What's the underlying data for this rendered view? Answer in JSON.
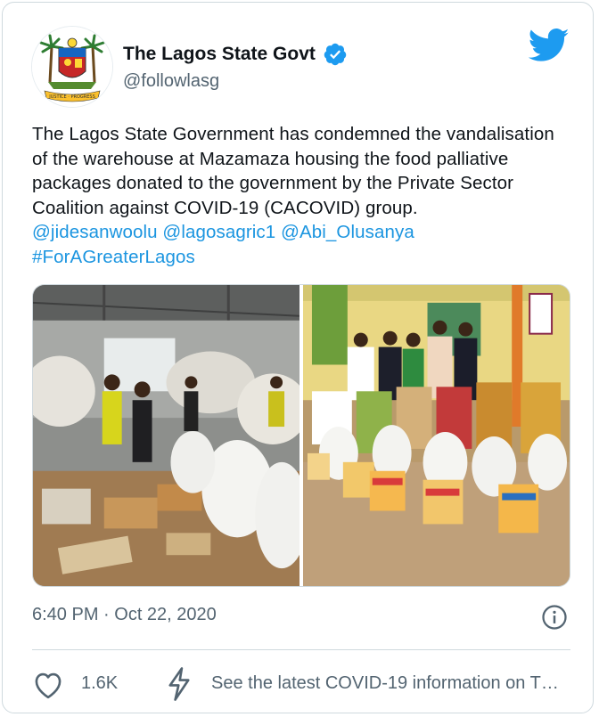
{
  "author": {
    "name": "The Lagos State Govt",
    "handle": "@followlasg",
    "verified": true,
    "avatar_icon": "lagos-state-coat-of-arms"
  },
  "tweet": {
    "text_lines": [
      "The Lagos State Government has condemned the vandalisation",
      "of the warehouse at Mazamaza housing the food palliative",
      "packages donated to the  government by the Private Sector",
      "Coalition against COVID-19 (CACOVID) group."
    ],
    "mentions_line": "@jidesanwoolu @lagosagric1 @Abi_Olusanya",
    "hashtag_line": "#ForAGreaterLagos"
  },
  "media": {
    "photos": [
      {
        "icon": "warehouse-photo"
      },
      {
        "icon": "palliative-distribution-photo"
      }
    ]
  },
  "meta": {
    "timestamp": "6:40 PM · Oct 22, 2020"
  },
  "actions": {
    "like_count": "1.6K",
    "covid_info": "See the latest COVID-19 information on T…"
  },
  "colors": {
    "accent": "#1b95e0",
    "twitter_blue": "#1d9bf0",
    "muted_text": "#536471"
  }
}
